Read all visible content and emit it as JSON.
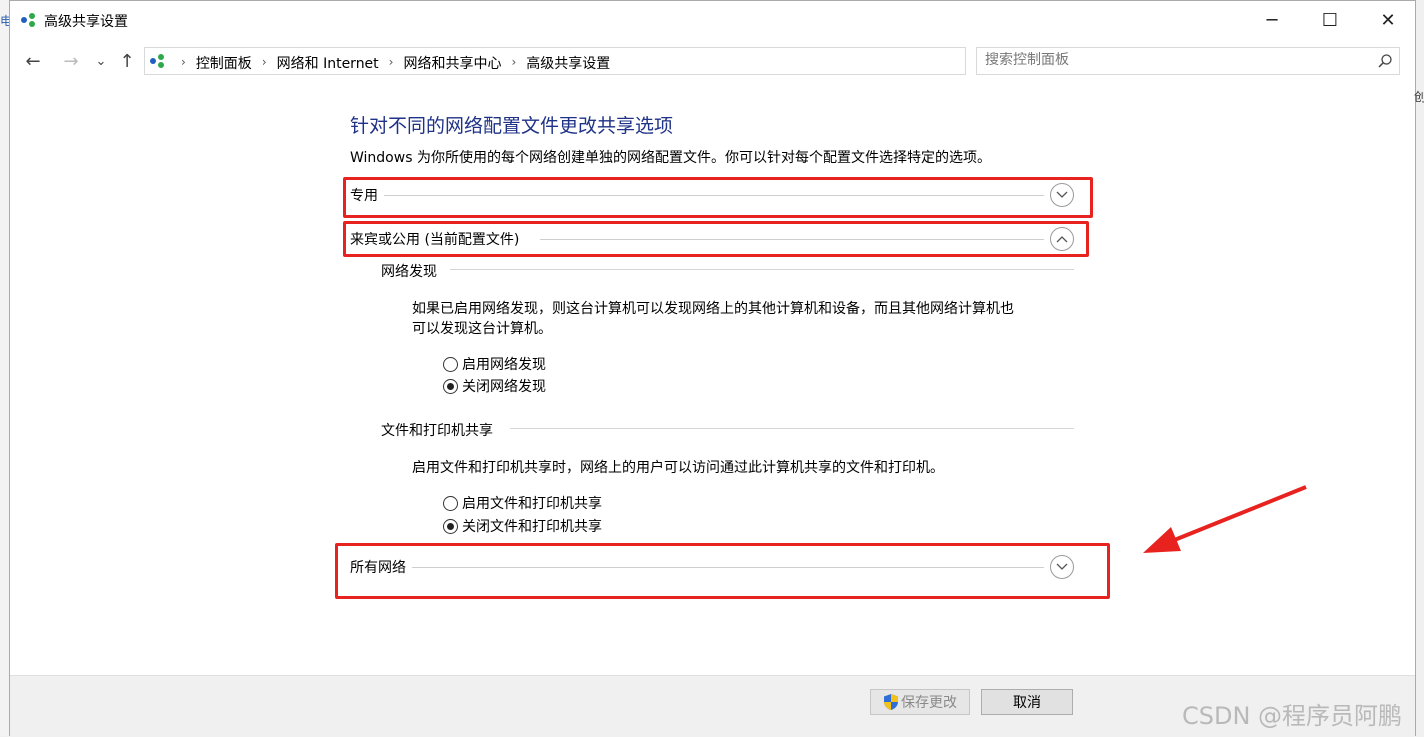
{
  "window": {
    "title": "高级共享设置",
    "minimize_glyph": "─",
    "maximize_glyph": "☐",
    "close_glyph": "✕"
  },
  "background": {
    "left_fragment": "电",
    "right_fragment": "创"
  },
  "nav": {
    "back_glyph": "←",
    "forward_glyph": "→",
    "recent_glyph": "⌄",
    "up_glyph": "↑"
  },
  "address": {
    "breadcrumbs": [
      {
        "label": "控制面板"
      },
      {
        "label": "网络和 Internet"
      },
      {
        "label": "网络和共享中心"
      },
      {
        "label": "高级共享设置"
      }
    ],
    "separator": "›",
    "dropdown_glyph": "⌄",
    "refresh_glyph": "↻"
  },
  "search": {
    "placeholder": "搜索控制面板"
  },
  "page": {
    "heading": "针对不同的网络配置文件更改共享选项",
    "description": "Windows 为你所使用的每个网络创建单独的网络配置文件。你可以针对每个配置文件选择特定的选项。"
  },
  "sections": {
    "private": {
      "label": "专用",
      "expanded": false
    },
    "guest_public": {
      "label": "来宾或公用 (当前配置文件)",
      "expanded": true
    },
    "all_networks": {
      "label": "所有网络",
      "expanded": false
    }
  },
  "network_discovery": {
    "heading": "网络发现",
    "text_line1": "如果已启用网络发现，则这台计算机可以发现网络上的其他计算机和设备，而且其他网络计算机也",
    "text_line2": "可以发现这台计算机。",
    "options": [
      {
        "label": "启用网络发现",
        "selected": false
      },
      {
        "label": "关闭网络发现",
        "selected": true
      }
    ]
  },
  "file_printer_sharing": {
    "heading": "文件和打印机共享",
    "text": "启用文件和打印机共享时，网络上的用户可以访问通过此计算机共享的文件和打印机。",
    "options": [
      {
        "label": "启用文件和打印机共享",
        "selected": false
      },
      {
        "label": "关闭文件和打印机共享",
        "selected": true
      }
    ]
  },
  "footer": {
    "save_label": "保存更改",
    "cancel_label": "取消"
  },
  "watermark": "CSDN @程序员阿鹏",
  "colors": {
    "annotation_red": "#e8231f",
    "heading_blue": "#1e3287"
  }
}
